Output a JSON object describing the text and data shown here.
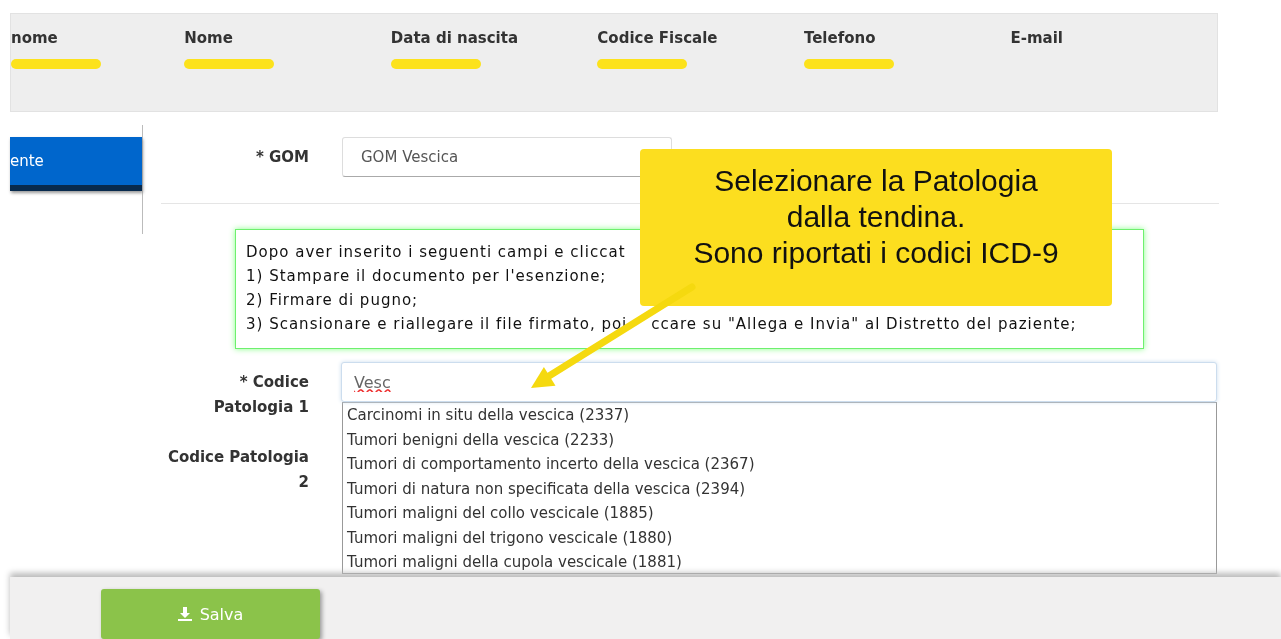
{
  "patient_header": [
    {
      "label": "nome",
      "redacted": true
    },
    {
      "label": "Nome",
      "redacted": true
    },
    {
      "label": "Data di nascita",
      "redacted": true
    },
    {
      "label": "Codice Fiscale",
      "redacted": true
    },
    {
      "label": "Telefono",
      "redacted": true
    },
    {
      "label": "E-mail",
      "redacted": false
    }
  ],
  "sidebar": {
    "button": "ente"
  },
  "form": {
    "gom": {
      "label": "* GOM",
      "value": "GOM Vescica"
    },
    "info_box": [
      "Dopo aver inserito i seguenti campi e cliccat",
      "1) Stampare il documento per l'esenzione;",
      "2) Firmare di pugno;",
      {
        "before": "3) Scansionare e riallegare il file firmato, poi",
        "after": "ccare su \"Allega e Invia\" al Distretto del paziente;"
      }
    ],
    "codice_1": {
      "label": "* Codice Patologia 1",
      "value": "Vesc"
    },
    "codice_2": {
      "label": "Codice Patologia 2"
    },
    "suggestions": [
      "Carcinomi in situ della vescica (2337)",
      "Tumori benigni della vescica (2233)",
      "Tumori di comportamento incerto della vescica (2367)",
      "Tumori di natura non specificata della vescica (2394)",
      "Tumori maligni del collo vescicale (1885)",
      "Tumori maligni del trigono vescicale (1880)",
      "Tumori maligni della cupola vescicale (1881)"
    ]
  },
  "callout": {
    "lines": [
      "Selezionare la Patologia",
      "dalla tendina.",
      "Sono riportati i codici ICD-9"
    ]
  },
  "footer": {
    "save_button": "Salva"
  }
}
